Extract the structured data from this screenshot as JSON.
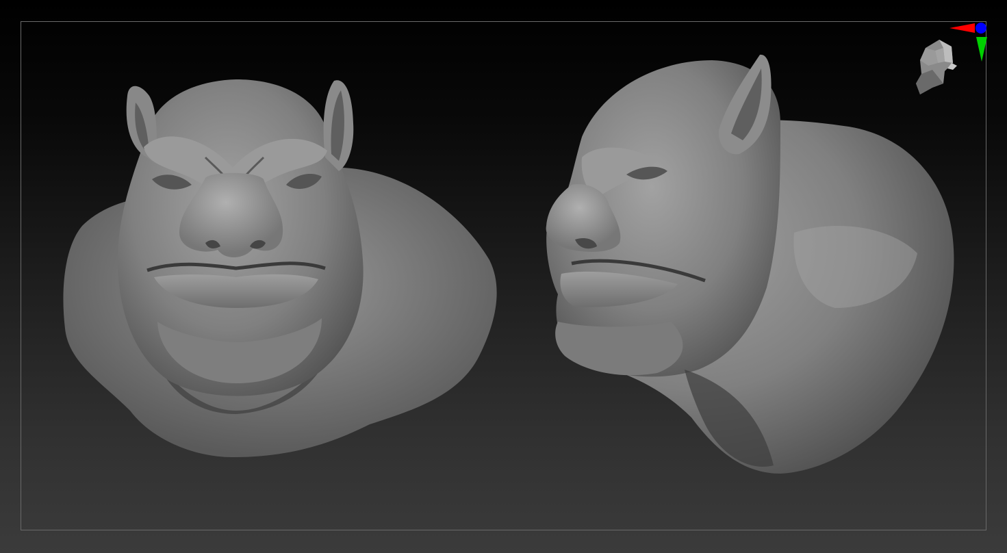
{
  "viewport": {
    "background_top": "#000000",
    "background_bottom": "#3b3b3b",
    "frame_color": "#6a6a6a"
  },
  "models": [
    {
      "name": "ogre-bust-front-view",
      "material_color": "#8c8c8c"
    },
    {
      "name": "ogre-bust-side-view",
      "material_color": "#8c8c8c"
    }
  ],
  "gizmo": {
    "x_axis_color": "#ff0000",
    "y_axis_color": "#00d000",
    "z_axis_color": "#0000ff",
    "head_icon": "head-orientation-icon"
  }
}
